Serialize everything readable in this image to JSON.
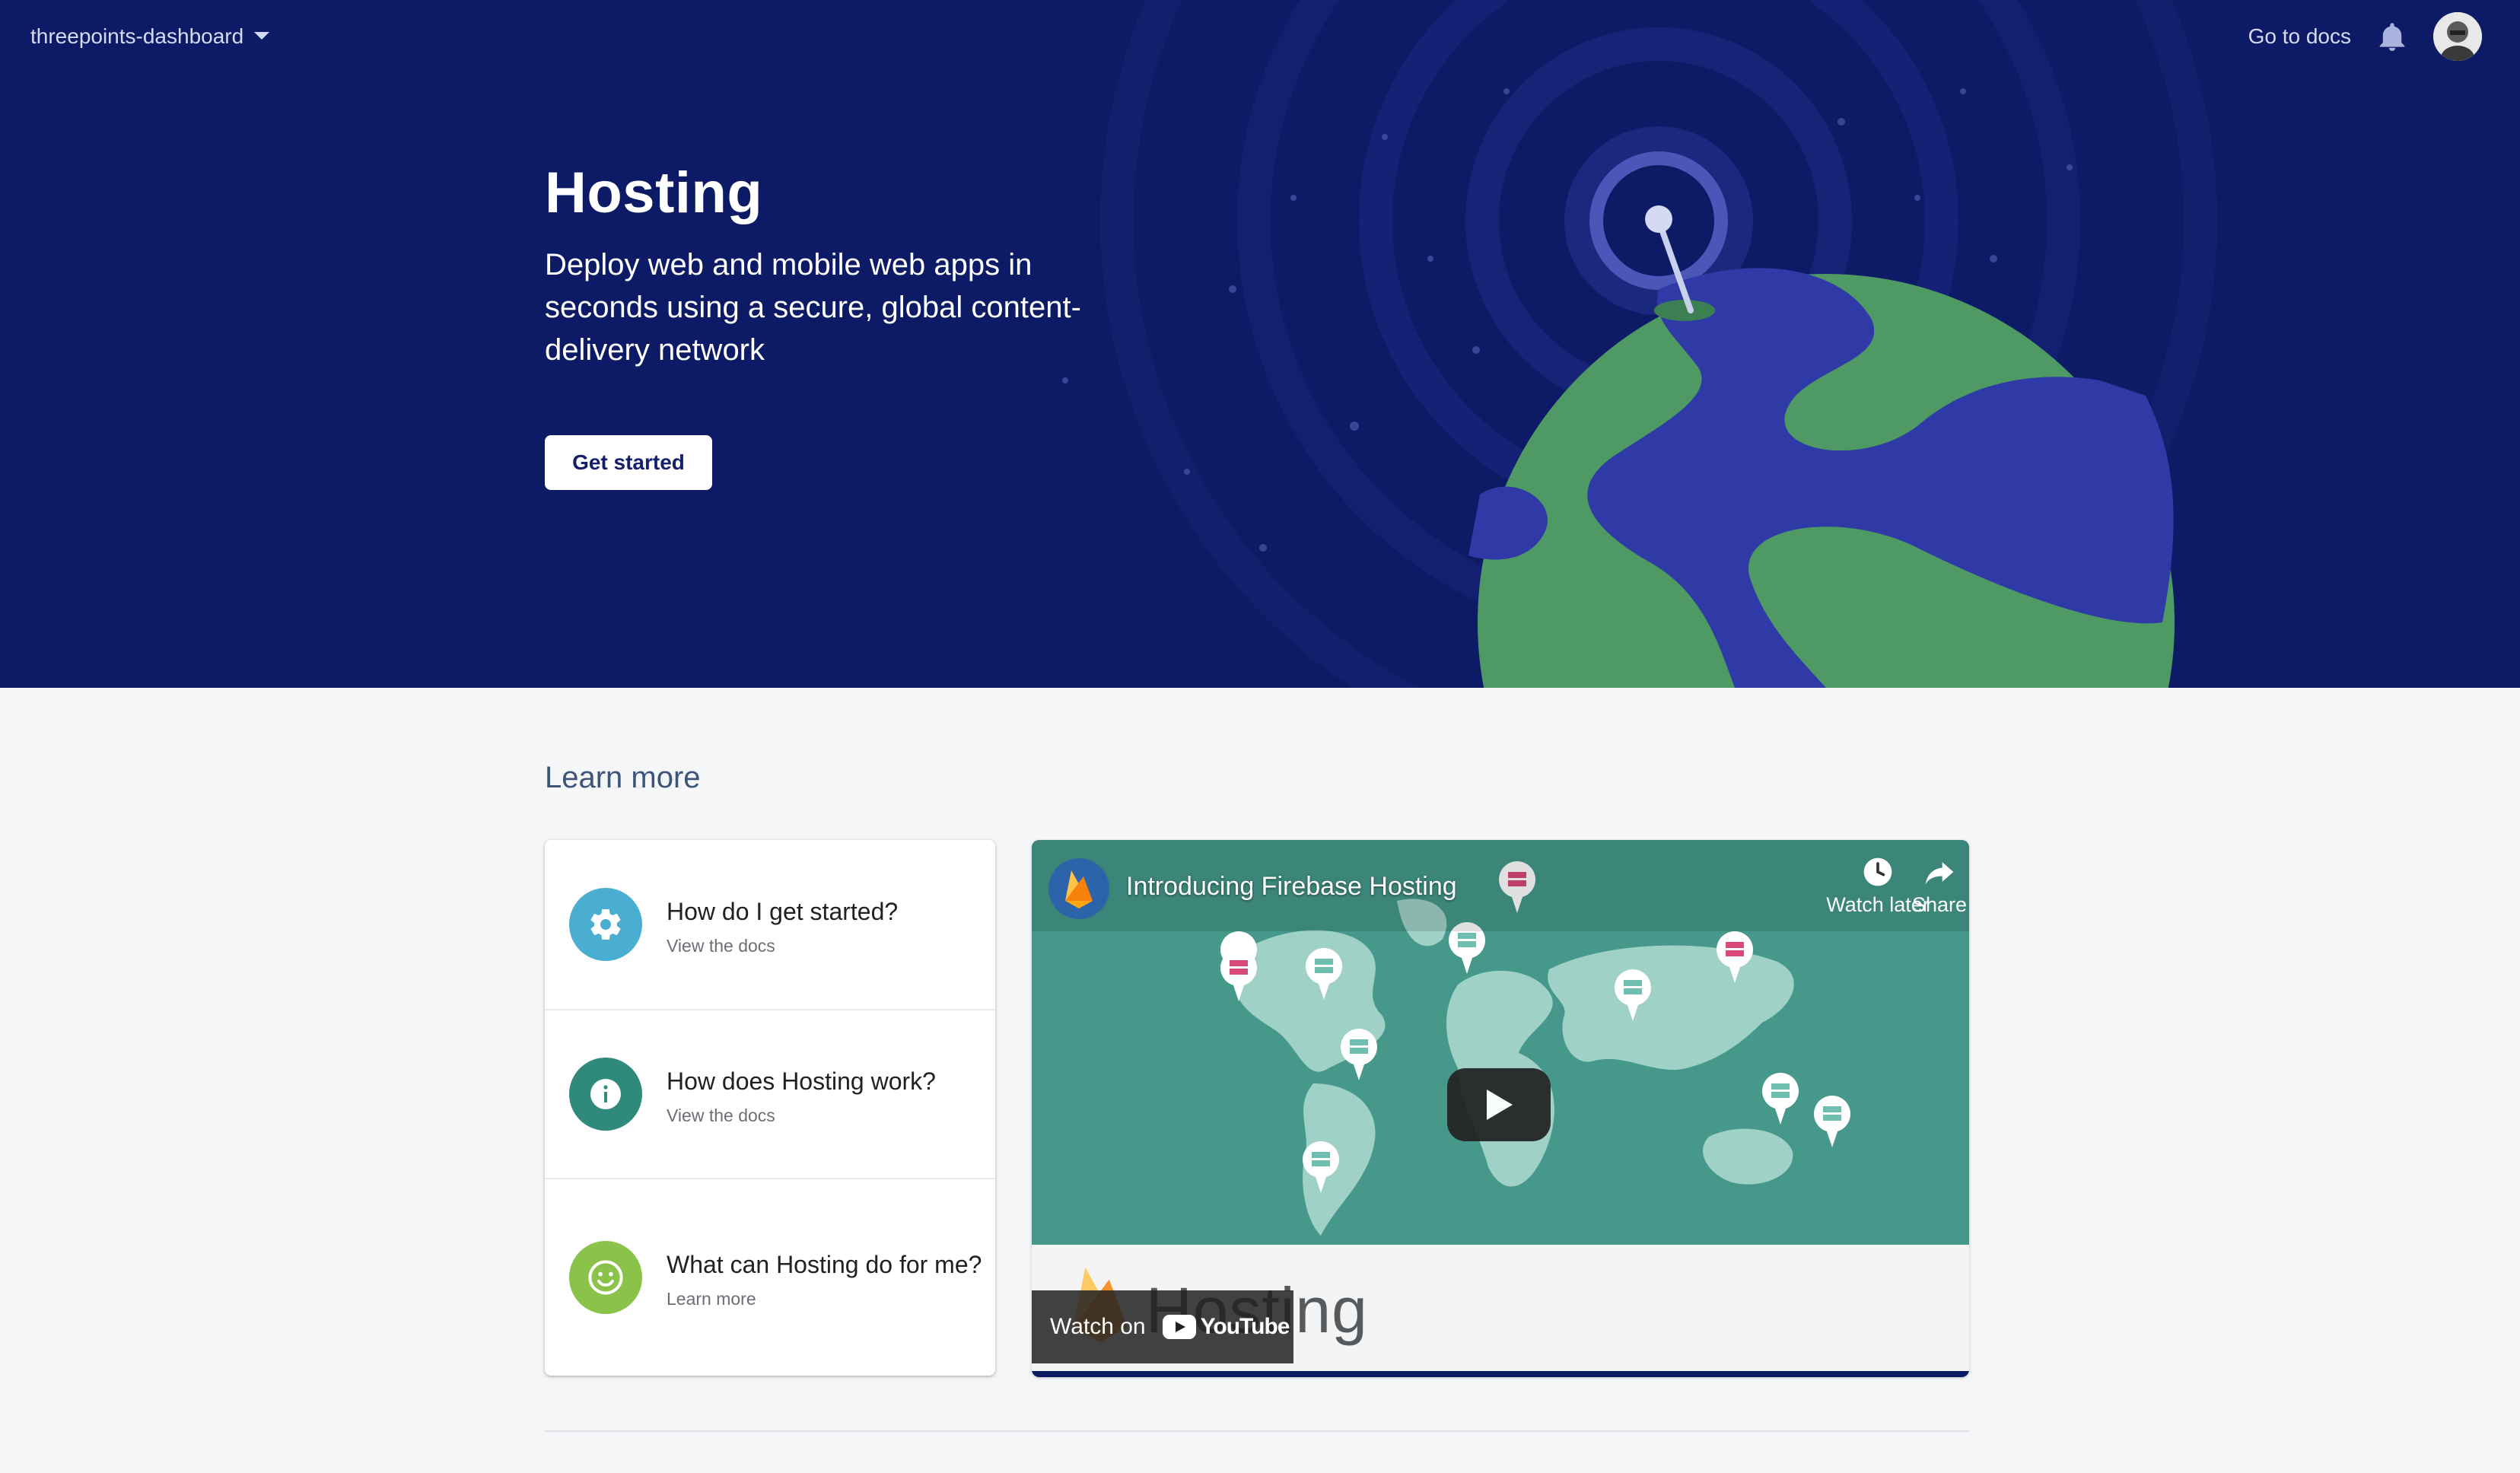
{
  "header": {
    "project_name": "threepoints-dashboard",
    "docs_link": "Go to docs"
  },
  "hero": {
    "title": "Hosting",
    "subtitle": "Deploy web and mobile web apps in seconds using a secure, global content-delivery network",
    "cta": "Get started"
  },
  "learn_more": {
    "heading": "Learn more",
    "items": [
      {
        "title": "How do I get started?",
        "link": "View the docs",
        "icon": "gear-icon",
        "color": "#4aaed0"
      },
      {
        "title": "How does Hosting work?",
        "link": "View the docs",
        "icon": "info-icon",
        "color": "#2f8a7c"
      },
      {
        "title": "What can Hosting do for me?",
        "link": "Learn more",
        "icon": "smiley-icon",
        "color": "#8bc34a"
      }
    ]
  },
  "video": {
    "title": "Introducing Firebase Hosting",
    "watch_later": "Watch later",
    "share": "Share",
    "watermark": "Hosting",
    "watch_on": "Watch on",
    "youtube": "YouTube"
  },
  "colors": {
    "hero_bg": "#0d1a66",
    "globe_land": "#4f9a64",
    "globe_water": "#2f3aa6",
    "video_bg": "#45988a"
  }
}
